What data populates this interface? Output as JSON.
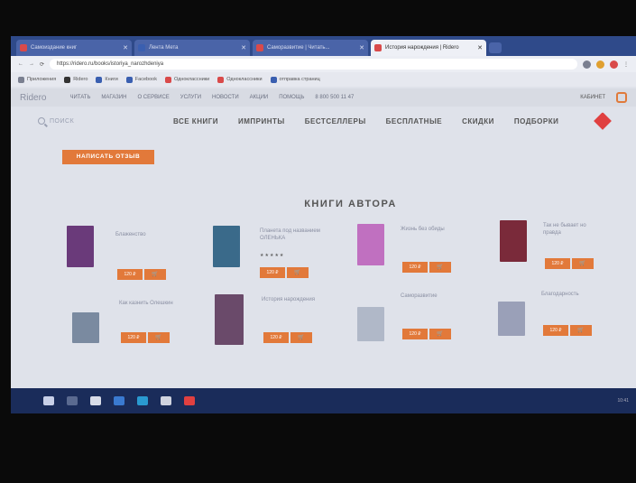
{
  "browser": {
    "tabs": [
      {
        "label": "Самоиздание книг",
        "color": "#d94a4a"
      },
      {
        "label": "Лента Мета",
        "color": "#3a5fb0"
      },
      {
        "label": "Саморазвитие | Читать...",
        "color": "#d94a4a"
      },
      {
        "label": "История нарождения | Ridero",
        "color": "#d94a4a",
        "active": true
      }
    ],
    "url": "https://ridero.ru/books/istoriya_narozhdeniya",
    "bookmarks": [
      "Приложения",
      "Ridero",
      "Книги",
      "Facebook",
      "Одноклассники",
      "Одноклассники",
      "отправка страниц"
    ]
  },
  "site": {
    "logo": "Ridero",
    "topnav": [
      "Читать",
      "Магазин",
      "О сервисе",
      "Услуги",
      "Новости",
      "Акции",
      "Помощь",
      "8 800 500 11 47"
    ],
    "cabinet": "КАБИНЕТ",
    "search_placeholder": "ПОИСК",
    "menu": [
      "ВСЕ КНИГИ",
      "ИМПРИНТЫ",
      "БЕСТСЕЛЛЕРЫ",
      "БЕСПЛАТНЫЕ",
      "СКИДКИ",
      "ПОДБОРКИ"
    ],
    "review_button": "НАПИСАТЬ ОТЗЫВ",
    "section_title": "КНИГИ АВТОРА"
  },
  "books": [
    {
      "title": "Блаженство",
      "price": "120 ₽",
      "cart": "🛒",
      "cover": "#6a3a7a"
    },
    {
      "title": "Планета под названием ОЛЕНЬКА",
      "price": "120 ₽",
      "cart": "🛒",
      "cover": "#3a6a8a",
      "stars": "★★★★★"
    },
    {
      "title": "Жизнь без обиды",
      "price": "120 ₽",
      "cart": "🛒",
      "cover": "#c070c0"
    },
    {
      "title": "Так не бывает но правда",
      "price": "120 ₽",
      "cart": "🛒",
      "cover": "#7a2a3a"
    },
    {
      "title": "Как казнить Олешкин",
      "price": "120 ₽",
      "cart": "🛒",
      "cover": "#7a8aa0"
    },
    {
      "title": "История нарождения",
      "price": "120 ₽",
      "cart": "🛒",
      "cover": "#6a4a6a"
    },
    {
      "title": "Саморазвитие",
      "price": "120 ₽",
      "cart": "🛒",
      "cover": "#b0b8c8"
    },
    {
      "title": "Благодарность",
      "price": "120 ₽",
      "cart": "🛒",
      "cover": "#9aa0b8"
    }
  ],
  "taskbar": {
    "clock": "10:41"
  }
}
